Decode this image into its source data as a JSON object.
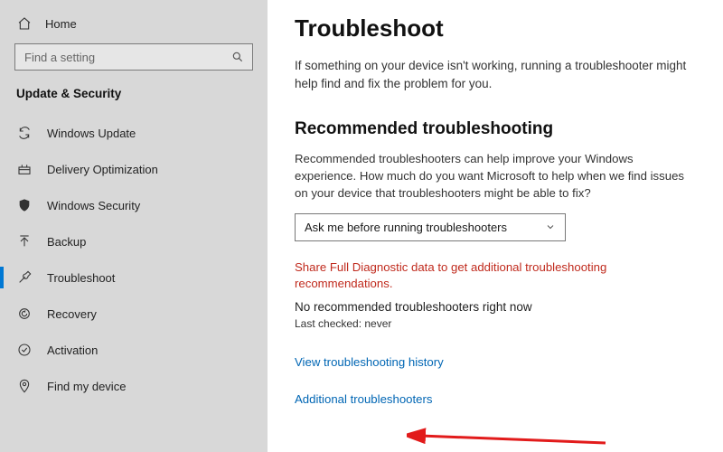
{
  "sidebar": {
    "home_label": "Home",
    "search_placeholder": "Find a setting",
    "category_label": "Update & Security",
    "items": [
      {
        "label": "Windows Update"
      },
      {
        "label": "Delivery Optimization"
      },
      {
        "label": "Windows Security"
      },
      {
        "label": "Backup"
      },
      {
        "label": "Troubleshoot"
      },
      {
        "label": "Recovery"
      },
      {
        "label": "Activation"
      },
      {
        "label": "Find my device"
      }
    ]
  },
  "main": {
    "title": "Troubleshoot",
    "intro": "If something on your device isn't working, running a troubleshooter might help find and fix the problem for you.",
    "section_title": "Recommended troubleshooting",
    "section_desc": "Recommended troubleshooters can help improve your Windows experience. How much do you want Microsoft to help when we find issues on your device that troubleshooters might be able to fix?",
    "dropdown_value": "Ask me before running troubleshooters",
    "diagnostic_warning": "Share Full Diagnostic data to get additional troubleshooting recommendations.",
    "no_recommended": "No recommended troubleshooters right now",
    "last_checked": "Last checked: never",
    "history_link": "View troubleshooting history",
    "additional_link": "Additional troubleshooters"
  }
}
